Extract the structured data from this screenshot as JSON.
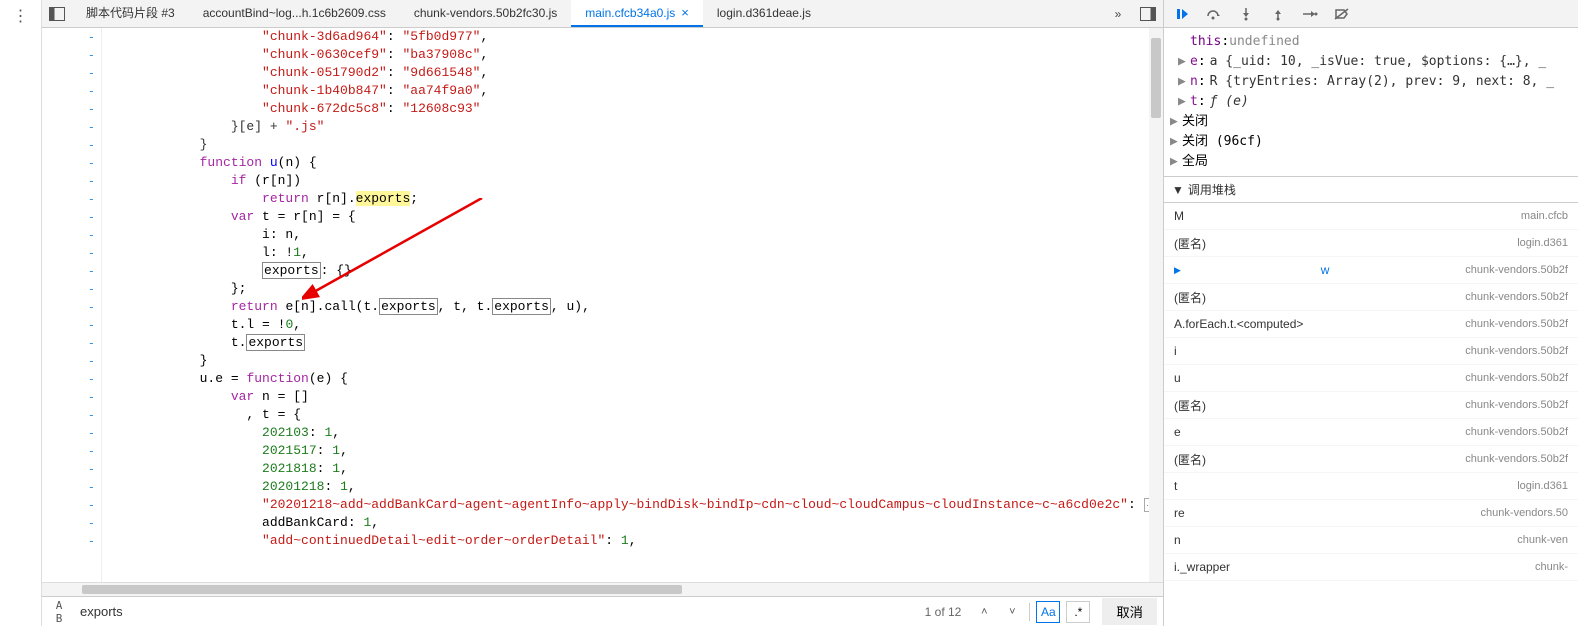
{
  "tabs": [
    {
      "label": "脚本代码片段 #3",
      "active": false
    },
    {
      "label": "accountBind~log...h.1c6b2609.css",
      "active": false
    },
    {
      "label": "chunk-vendors.50b2fc30.js",
      "active": false
    },
    {
      "label": "main.cfcb34a0.js",
      "active": true
    },
    {
      "label": "login.d361deae.js",
      "active": false
    }
  ],
  "code": {
    "chunks": [
      {
        "k": "\"chunk-3d6ad964\"",
        "v": "\"5fb0d977\""
      },
      {
        "k": "\"chunk-0630cef9\"",
        "v": "\"ba37908c\""
      },
      {
        "k": "\"chunk-051790d2\"",
        "v": "\"9d661548\""
      },
      {
        "k": "\"chunk-1b40b847\"",
        "v": "\"aa74f9a0\""
      },
      {
        "k": "\"chunk-672dc5c8\"",
        "v": "\"12608c93\""
      }
    ],
    "suffix_line": "}[e] + \".js\"",
    "func_decl": "function u(n) {",
    "if_cond": "if (r[n])",
    "return_stmt_pre": "return r[n].",
    "exports_hl": "exports",
    "var_decl": "var t = r[n] = {",
    "obj_i": "i: n,",
    "obj_l": "l: !1,",
    "exports_boxed": "exports",
    "obj_exports_after": ": {}",
    "close1": "};",
    "return2_pre": "return e[n].call(t.",
    "return2_mid": ", t, t.",
    "return2_post": ", u),",
    "tl": "t.l = !0,",
    "texports_pre": "t.",
    "close2": "}",
    "ue": "u.e = function(e) {",
    "varn_decl": "var n = []",
    "t_decl_open": "  , t = {",
    "ids": [
      {
        "k": "202103",
        "v": "1"
      },
      {
        "k": "2021517",
        "v": "1"
      },
      {
        "k": "2021818",
        "v": "1"
      },
      {
        "k": "20201218",
        "v": "1"
      }
    ],
    "long1_key": "\"20201218~add~addBankCard~agent~agentInfo~apply~bindDisk~bindIp~cdn~cloud~cloudCampus~cloudInstance~c~a6cd0e2c\"",
    "addbank": "addBankCard: 1,",
    "long2_key": "\"add~continuedDetail~edit~order~orderDetail\"",
    "long2_val": "1"
  },
  "search": {
    "value": "exports",
    "count": "1 of 12",
    "cancel": "取消",
    "caseLabel": "Aa",
    "regexLabel": ".*"
  },
  "scope": {
    "this": {
      "label": "this",
      "value": "undefined"
    },
    "e": {
      "label": "e",
      "value": "a {_uid: 10, _isVue: true, $options: {…}, _"
    },
    "n": {
      "label": "n",
      "value": "R {tryEntries: Array(2), prev: 9, next: 8, _"
    },
    "t": {
      "label": "t",
      "value": "ƒ (e)"
    },
    "closures": [
      "关闭",
      "关闭 (96cf)",
      "全局"
    ]
  },
  "section_callstack": "调用堆栈",
  "stack": [
    {
      "fn": "M",
      "src": "main.cfcb",
      "current": false
    },
    {
      "fn": "(匿名)",
      "src": "login.d361",
      "current": false
    },
    {
      "fn": "w",
      "src": "chunk-vendors.50b2f",
      "current": true
    },
    {
      "fn": "(匿名)",
      "src": "chunk-vendors.50b2f",
      "current": false
    },
    {
      "fn": "A.forEach.t.<computed>",
      "src": "chunk-vendors.50b2f",
      "current": false
    },
    {
      "fn": "i",
      "src": "chunk-vendors.50b2f",
      "current": false
    },
    {
      "fn": "u",
      "src": "chunk-vendors.50b2f",
      "current": false
    },
    {
      "fn": "(匿名)",
      "src": "chunk-vendors.50b2f",
      "current": false
    },
    {
      "fn": "e",
      "src": "chunk-vendors.50b2f",
      "current": false
    },
    {
      "fn": "(匿名)",
      "src": "chunk-vendors.50b2f",
      "current": false
    },
    {
      "fn": "t",
      "src": "login.d361",
      "current": false
    },
    {
      "fn": "re",
      "src": "chunk-vendors.50",
      "current": false
    },
    {
      "fn": "n",
      "src": "chunk-ven",
      "current": false
    },
    {
      "fn": "i._wrapper",
      "src": "chunk-",
      "current": false
    }
  ]
}
